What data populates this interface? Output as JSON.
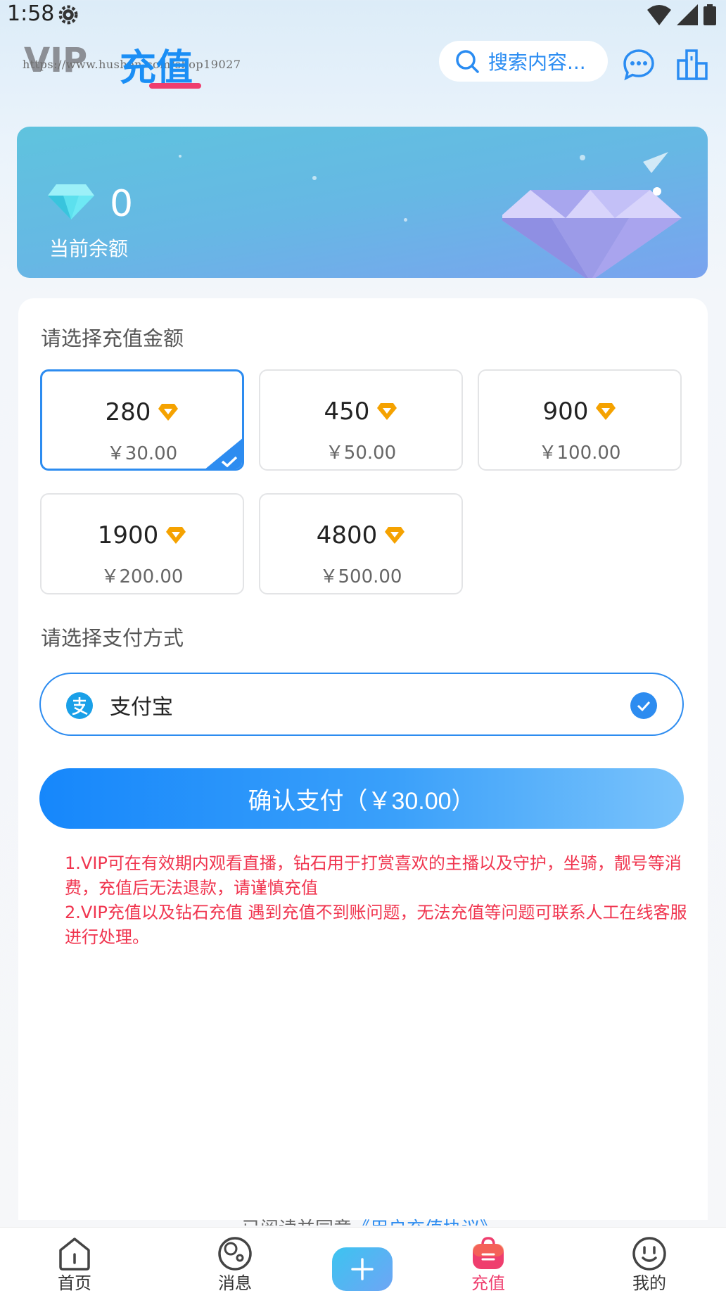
{
  "status_bar": {
    "time": "1:58"
  },
  "header": {
    "tabs": [
      {
        "label": "VIP"
      },
      {
        "label": "充值"
      }
    ],
    "watermark": "https://www.hushen.com/shop19027",
    "search_placeholder": "搜索内容..."
  },
  "balance": {
    "value": "0",
    "label": "当前余额"
  },
  "recharge": {
    "title": "请选择充值金额",
    "options": [
      {
        "diamonds": "280",
        "price": "￥30.00",
        "selected": true
      },
      {
        "diamonds": "450",
        "price": "￥50.00",
        "selected": false
      },
      {
        "diamonds": "900",
        "price": "￥100.00",
        "selected": false
      },
      {
        "diamonds": "1900",
        "price": "￥200.00",
        "selected": false
      },
      {
        "diamonds": "4800",
        "price": "￥500.00",
        "selected": false
      }
    ]
  },
  "payment": {
    "title": "请选择支付方式",
    "method": "支付宝",
    "confirm_label": "确认支付（￥30.00）"
  },
  "notes": [
    "1.VIP可在有效期内观看直播，钻石用于打赏喜欢的主播以及守护，坐骑，靓号等消费，充值后无法退款，请谨慎充值",
    "2.VIP充值以及钻石充值 遇到充值不到账问题，无法充值等问题可联系人工在线客服进行处理。"
  ],
  "agreement": {
    "prefix": "已阅读并同意",
    "link": "《用户充值协议》"
  },
  "bottom_nav": [
    {
      "label": "首页"
    },
    {
      "label": "消息"
    },
    {
      "label": "充值"
    },
    {
      "label": "我的"
    }
  ],
  "colors": {
    "accent": "#2d8cf0",
    "active_tab": "#1a8ef5",
    "highlight": "#ef3e6e",
    "note_red": "#f0354f",
    "gold": "#f5a200"
  }
}
